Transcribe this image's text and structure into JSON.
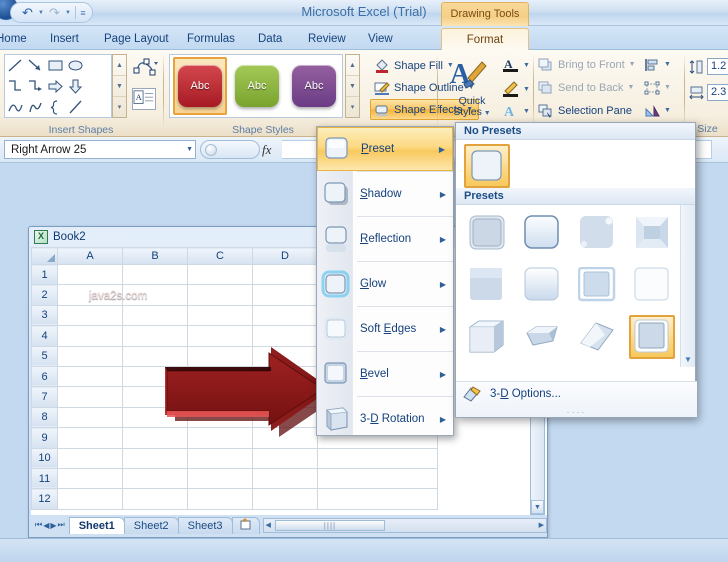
{
  "window": {
    "title": "Microsoft Excel (Trial)",
    "contextual_tab": "Drawing Tools"
  },
  "quick_access": {
    "items": [
      {
        "name": "office-button",
        "label": ""
      },
      {
        "name": "undo",
        "label": "↶"
      },
      {
        "name": "redo",
        "label": "↷"
      },
      {
        "name": "customize",
        "label": "☷"
      }
    ]
  },
  "tabs": [
    {
      "label": "Home",
      "active": false
    },
    {
      "label": "Insert",
      "active": false
    },
    {
      "label": "Page Layout",
      "active": false
    },
    {
      "label": "Formulas",
      "active": false
    },
    {
      "label": "Data",
      "active": false
    },
    {
      "label": "Review",
      "active": false
    },
    {
      "label": "View",
      "active": false
    },
    {
      "label": "Format",
      "active": true
    }
  ],
  "ribbon": {
    "groups": [
      {
        "label": "Insert Shapes"
      },
      {
        "label": "Shape Styles"
      },
      {
        "label": "Size"
      }
    ],
    "shape_effects": {
      "fill_label": "Shape Fill",
      "outline_label": "Shape Outline",
      "effects_label": "Shape Effects"
    },
    "quick_styles": {
      "label_line1": "Quick",
      "label_line2": "Styles"
    },
    "arrange": {
      "bring_to_front": "Bring to Front",
      "send_to_back": "Send to Back",
      "selection_pane": "Selection Pane"
    },
    "size": {
      "height_value": "1.2",
      "width_value": "2.3"
    },
    "style_swatches": [
      {
        "label": "Abc",
        "color": "#c0242c",
        "selected": true
      },
      {
        "label": "Abc",
        "color": "#8cb53c",
        "selected": false
      },
      {
        "label": "Abc",
        "color": "#7c4b9e",
        "selected": false
      }
    ]
  },
  "formula_bar": {
    "name_box_value": "Right Arrow 25",
    "fx_label": "fx",
    "input_value": ""
  },
  "workbook": {
    "title": "Book2",
    "columns": [
      "A",
      "B",
      "C",
      "D"
    ],
    "rows": [
      "1",
      "2",
      "3",
      "4",
      "5",
      "6",
      "7",
      "8",
      "9",
      "10",
      "11",
      "12"
    ],
    "shape": {
      "name": "Right Arrow 25",
      "text": "java2s.com",
      "color": "#9e1b1b"
    },
    "sheet_tabs": [
      {
        "label": "Sheet1",
        "active": true
      },
      {
        "label": "Sheet2",
        "active": false
      },
      {
        "label": "Sheet3",
        "active": false
      }
    ],
    "insert_sheet_tab": "insert-worksheet"
  },
  "shape_effects_menu": {
    "items": [
      {
        "label": "Preset",
        "accel": "P",
        "selected": true,
        "has_submenu": true
      },
      {
        "label": "Shadow",
        "accel": "S",
        "selected": false,
        "has_submenu": true
      },
      {
        "label": "Reflection",
        "accel": "R",
        "selected": false,
        "has_submenu": true
      },
      {
        "label": "Glow",
        "accel": "G",
        "selected": false,
        "has_submenu": true
      },
      {
        "label": "Soft Edges",
        "accel": "E",
        "selected": false,
        "has_submenu": true
      },
      {
        "label": "Bevel",
        "accel": "B",
        "selected": false,
        "has_submenu": true
      },
      {
        "label": "3-D Rotation",
        "accel": "D",
        "selected": false,
        "has_submenu": true
      }
    ]
  },
  "presets_gallery": {
    "no_presets_header": "No Presets",
    "presets_header": "Presets",
    "footer_label": "3-D Options...",
    "no_preset_items": [
      {
        "name": "no-preset",
        "selected": true
      }
    ],
    "preset_items": [
      {
        "name": "preset-1",
        "selected": false
      },
      {
        "name": "preset-2",
        "selected": false
      },
      {
        "name": "preset-3",
        "selected": false
      },
      {
        "name": "preset-4",
        "selected": false
      },
      {
        "name": "preset-5",
        "selected": false
      },
      {
        "name": "preset-6",
        "selected": false
      },
      {
        "name": "preset-7",
        "selected": false
      },
      {
        "name": "preset-8",
        "selected": false
      },
      {
        "name": "preset-9",
        "selected": false
      },
      {
        "name": "preset-10",
        "selected": false
      },
      {
        "name": "preset-11",
        "selected": false
      },
      {
        "name": "preset-12",
        "selected": true
      }
    ]
  },
  "colors": {
    "accent_orange": "#f6b437",
    "ribbon_bg": "#f6efe0",
    "chrome_blue": "#c3d9f0",
    "text_blue": "#16417c"
  }
}
